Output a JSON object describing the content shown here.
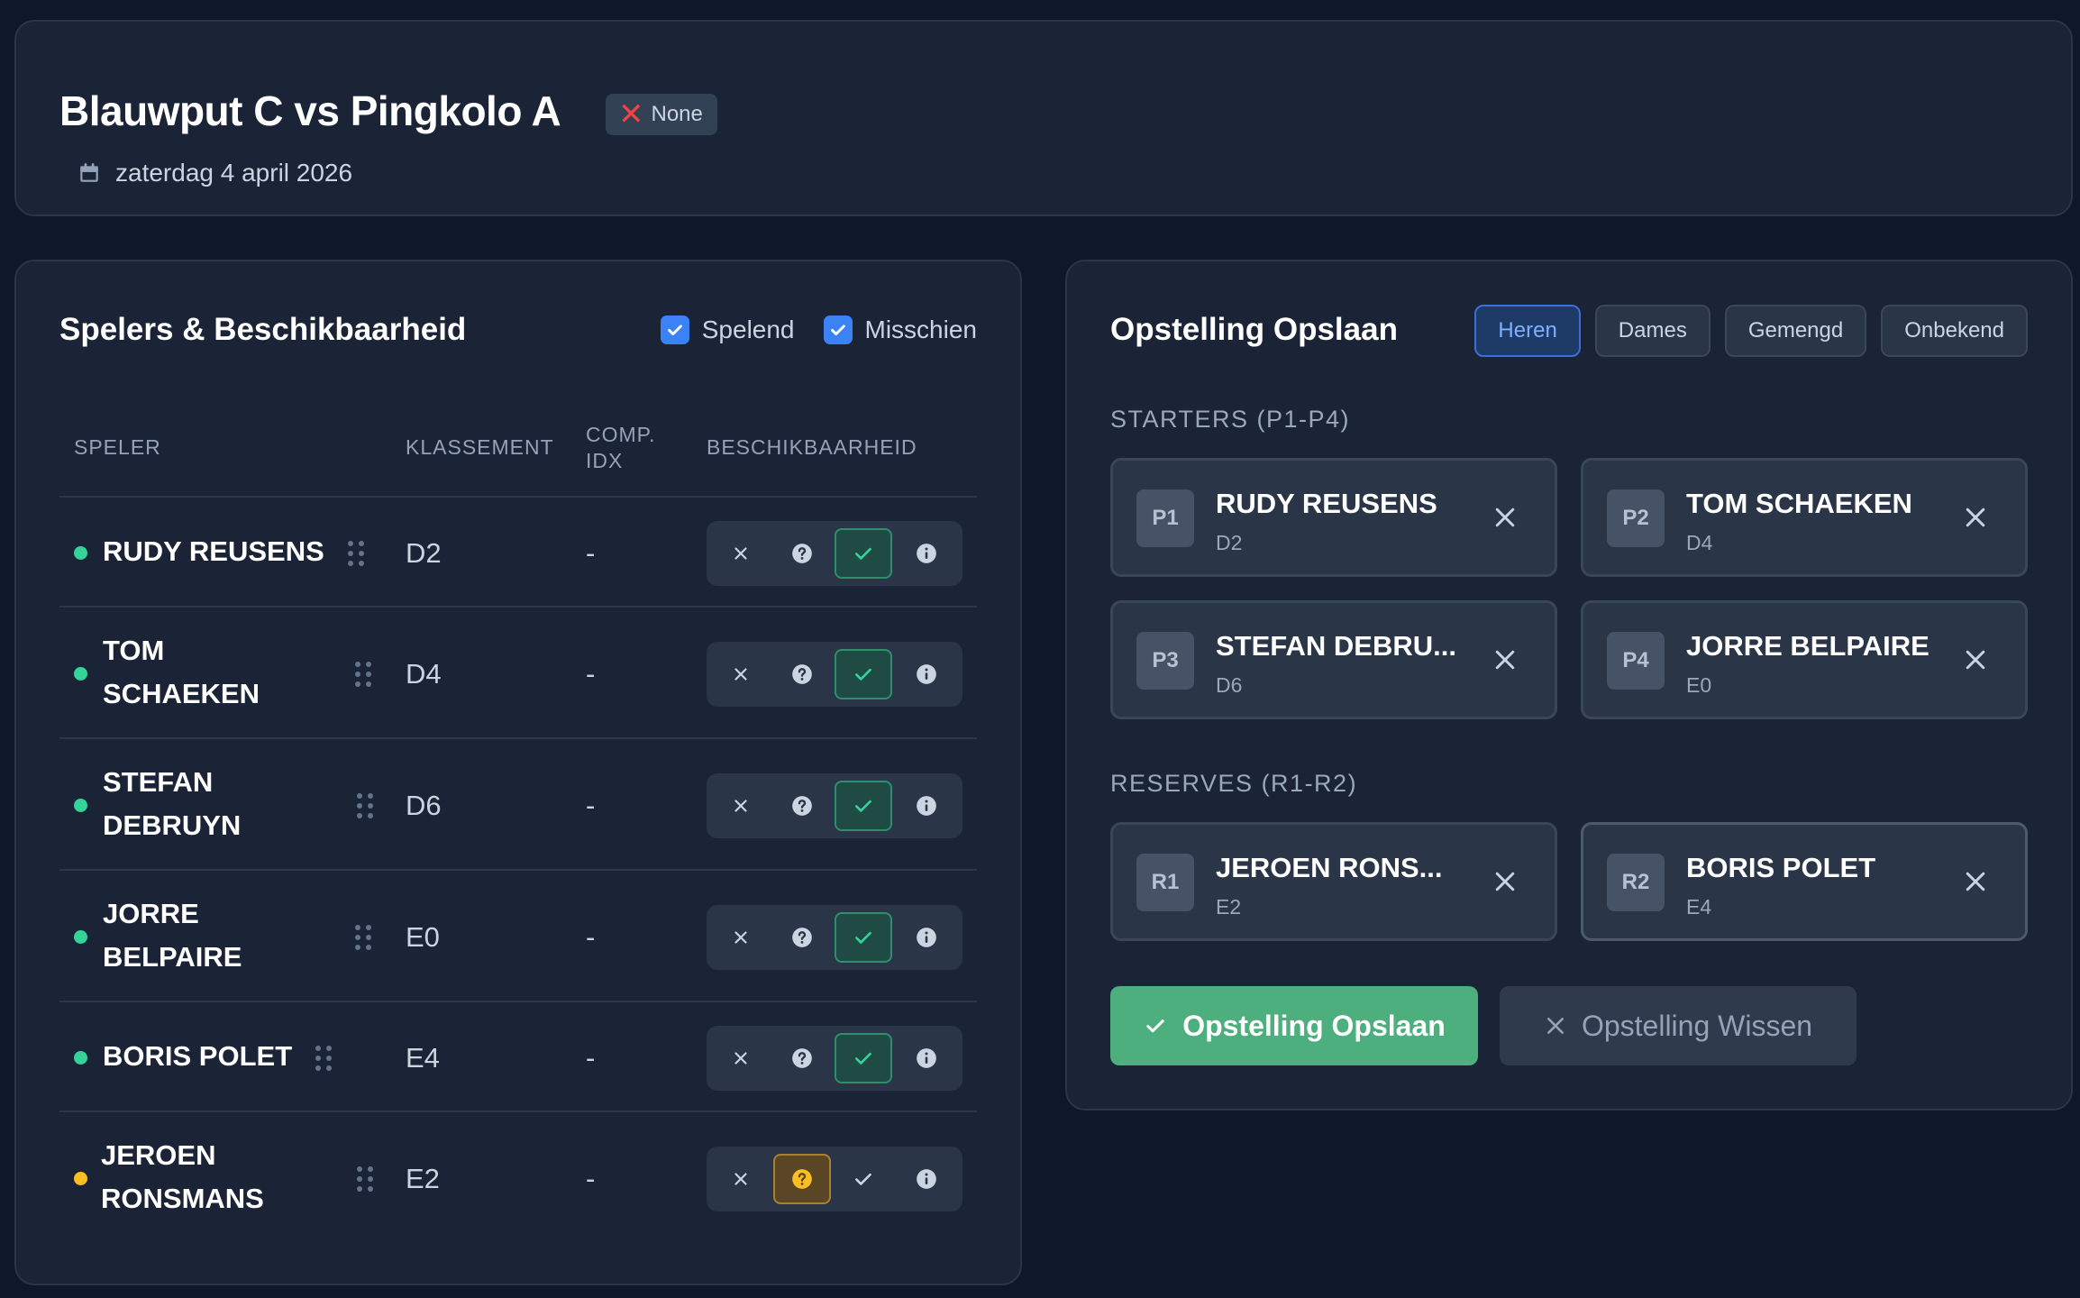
{
  "match": {
    "title": "Blauwput C vs Pingkolo A",
    "status_label": "None",
    "status_icon": "x-mark-icon",
    "date": "zaterdag 4 april 2026"
  },
  "players_panel": {
    "title": "Spelers & Beschikbaarheid",
    "filters": [
      {
        "label": "Spelend",
        "checked": true
      },
      {
        "label": "Misschien",
        "checked": true
      }
    ],
    "columns": {
      "player": "SPELER",
      "ranking": "KLASSEMENT",
      "comp_idx_line1": "COMP.",
      "comp_idx_line2": "IDX",
      "availability": "BESCHIKBAARHEID"
    },
    "players": [
      {
        "name": "RUDY REUSENS",
        "ranking": "D2",
        "comp_idx": "-",
        "status": "playing"
      },
      {
        "name_line1": "TOM",
        "name_line2": "SCHAEKEN",
        "ranking": "D4",
        "comp_idx": "-",
        "status": "playing"
      },
      {
        "name_line1": "STEFAN",
        "name_line2": "DEBRUYN",
        "ranking": "D6",
        "comp_idx": "-",
        "status": "playing"
      },
      {
        "name_line1": "JORRE",
        "name_line2": "BELPAIRE",
        "ranking": "E0",
        "comp_idx": "-",
        "status": "playing"
      },
      {
        "name": "BORIS POLET",
        "ranking": "E4",
        "comp_idx": "-",
        "status": "playing"
      },
      {
        "name_line1": "JEROEN",
        "name_line2": "RONSMANS",
        "ranking": "E2",
        "comp_idx": "-",
        "status": "maybe"
      }
    ]
  },
  "lineup_panel": {
    "title": "Opstelling Opslaan",
    "tabs": [
      "Heren",
      "Dames",
      "Gemengd",
      "Onbekend"
    ],
    "active_tab": "Heren",
    "starters_label": "STARTERS (P1-P4)",
    "reserves_label": "RESERVES (R1-R2)",
    "starters": [
      {
        "slot": "P1",
        "name": "RUDY REUSENS",
        "ranking": "D2"
      },
      {
        "slot": "P2",
        "name": "TOM SCHAEKEN",
        "ranking": "D4"
      },
      {
        "slot": "P3",
        "name": "STEFAN DEBRU...",
        "ranking": "D6"
      },
      {
        "slot": "P4",
        "name": "JORRE BELPAIRE",
        "ranking": "E0"
      }
    ],
    "reserves": [
      {
        "slot": "R1",
        "name": "JEROEN RONS...",
        "ranking": "E2"
      },
      {
        "slot": "R2",
        "name": "BORIS POLET",
        "ranking": "E4"
      }
    ],
    "save_label": "Opstelling Opslaan",
    "clear_label": "Opstelling Wissen"
  },
  "colors": {
    "background": "#0f172a",
    "card": "#1a2436",
    "accent_blue": "#3b82f6",
    "playing_green": "#34d399",
    "maybe_yellow": "#fbbf24",
    "save_green": "#4caf7d"
  }
}
